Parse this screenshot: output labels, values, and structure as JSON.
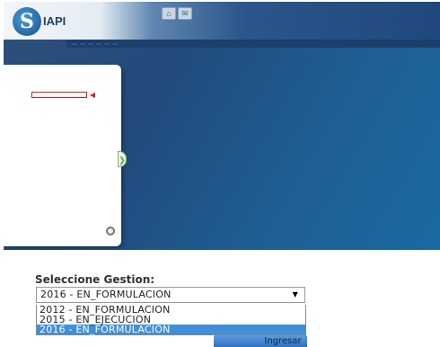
{
  "header": {
    "logo_letter": "S",
    "logo_text": "IAPI",
    "icon_home": "⌂",
    "icon_mail": "✉",
    "info_lines": [
      "",
      "",
      ""
    ]
  },
  "menubar": {
    "items": [
      "",
      "",
      "",
      "",
      "",
      ""
    ]
  },
  "sidebar": {
    "tree_lines": [
      "",
      "",
      "",
      ""
    ],
    "highlighted_item": "",
    "collapse_glyph": "❯"
  },
  "form": {
    "label": "Seleccione Gestion:",
    "select_value": "2016 - EN_FORMULACION",
    "options": [
      "2012 - EN_FORMULACION",
      "2015 - EN_EJECUCION",
      "2016 - EN_FORMULACION"
    ],
    "selected_index": 2,
    "submit_label": "Ingresar"
  },
  "colors": {
    "accent_blue": "#3f8fd9",
    "header_dark": "#20487c",
    "highlight_red": "#d91c1c"
  }
}
